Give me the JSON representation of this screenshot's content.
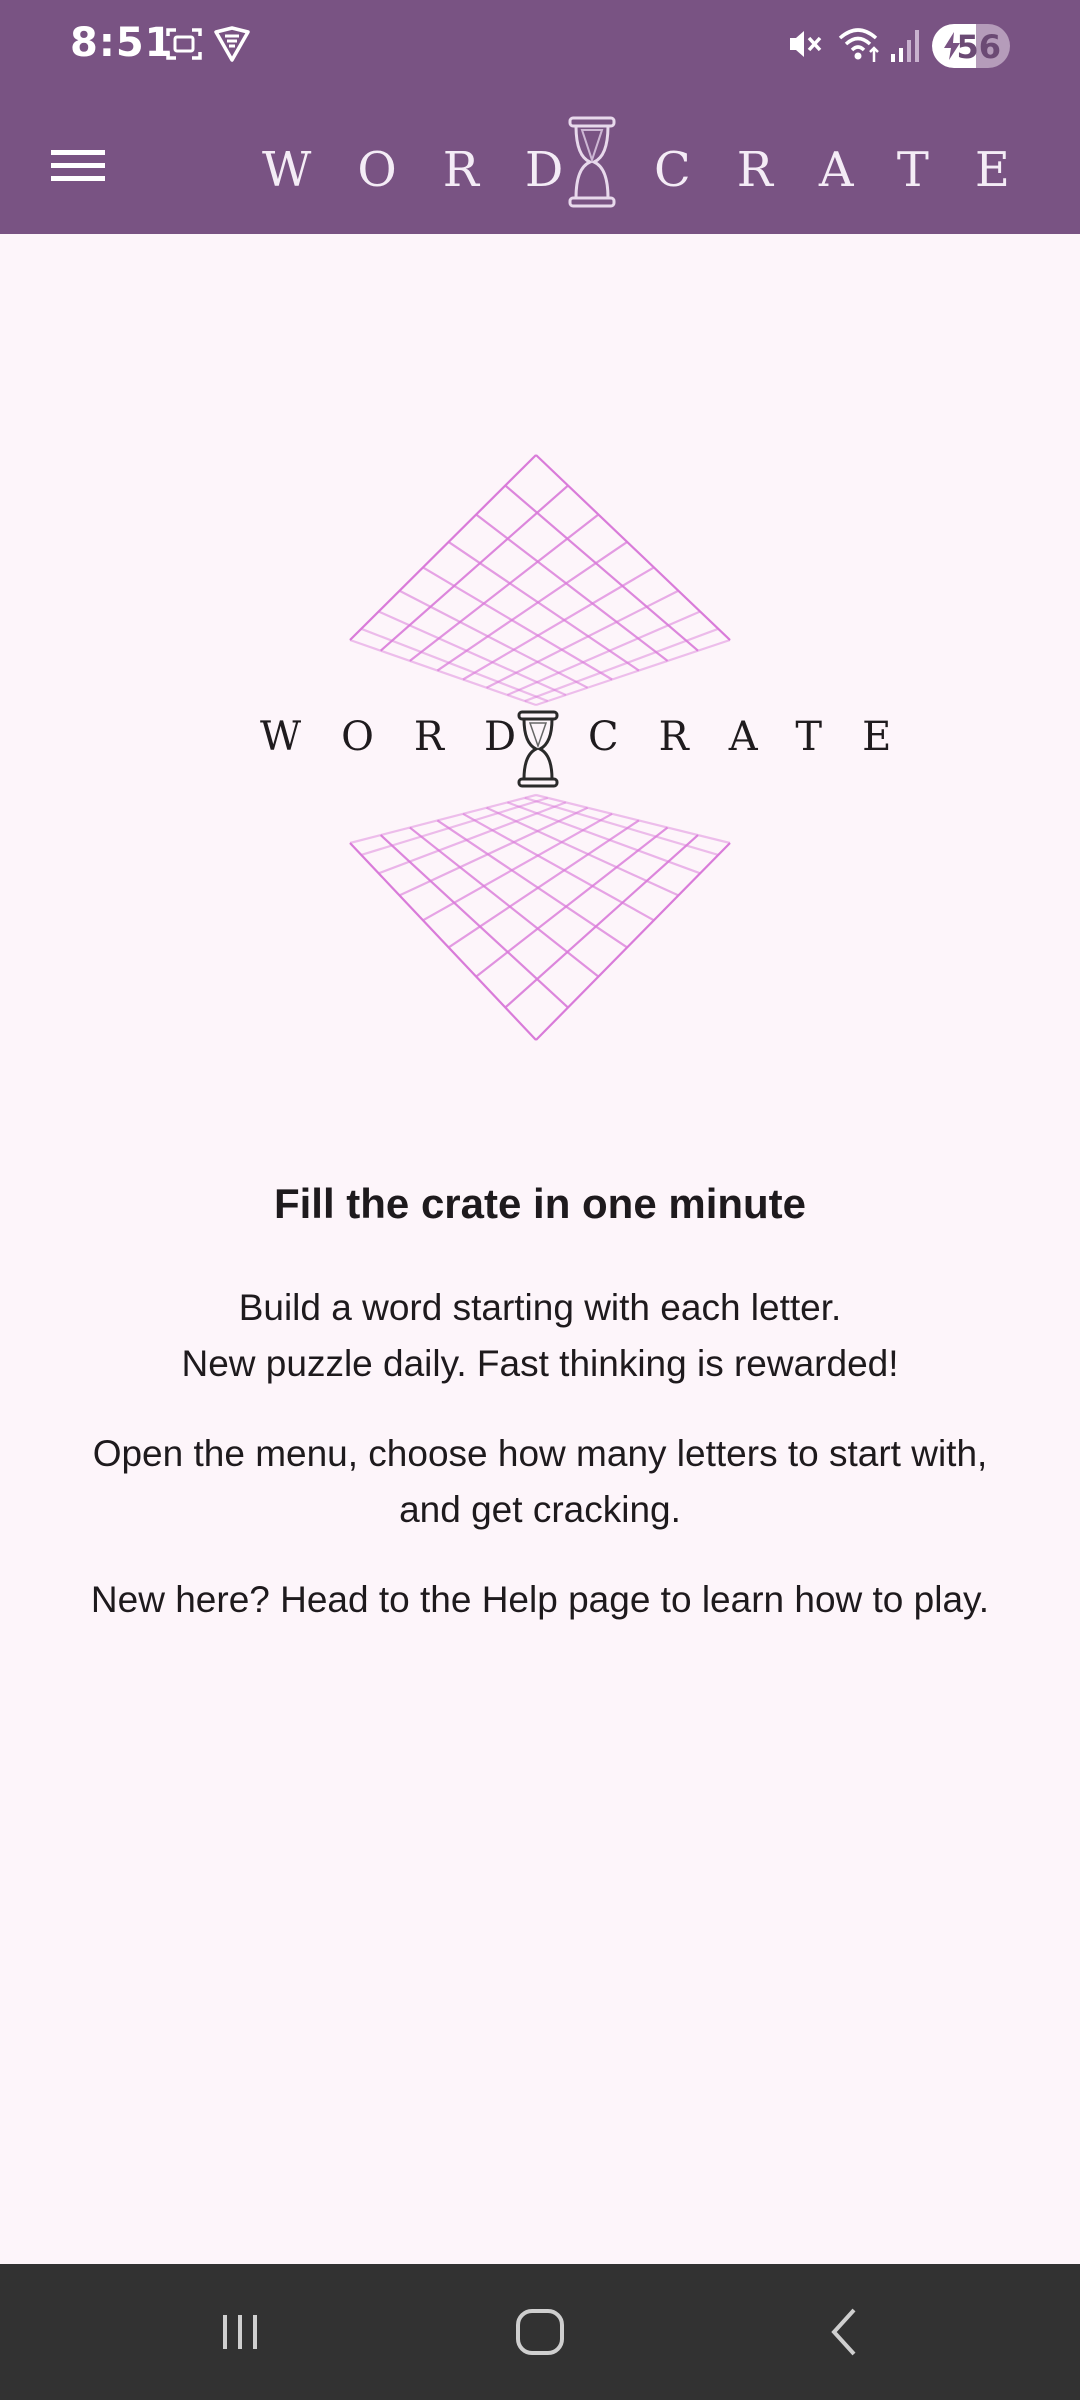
{
  "status_bar": {
    "time": "8:51",
    "battery_level": "56",
    "battery_fraction": 0.56,
    "icons": [
      "screenshot-icon",
      "vpn-shield-icon",
      "mute-icon",
      "wifi-icon",
      "signal-icon",
      "charging-icon"
    ]
  },
  "app_bar": {
    "logo_left": "WORD",
    "logo_right": "CRATE",
    "menu_icon": "hamburger-menu-icon"
  },
  "hero": {
    "logo_left": "WORD",
    "logo_right": "CRATE"
  },
  "content": {
    "headline": "Fill the crate in one minute",
    "para1_line1": "Build a word starting with each letter.",
    "para1_line2": "New puzzle daily. Fast thinking is rewarded!",
    "para2": "Open the menu, choose how many letters to start with, and get cracking.",
    "para3": "New here? Head to the Help page to learn how to play."
  },
  "nav_bar": {
    "buttons": [
      "recent-apps-icon",
      "home-icon",
      "back-icon"
    ]
  },
  "colors": {
    "header": "#795383",
    "background": "#fdf5fa",
    "grid": "#d97bd9",
    "nav": "#323232"
  }
}
